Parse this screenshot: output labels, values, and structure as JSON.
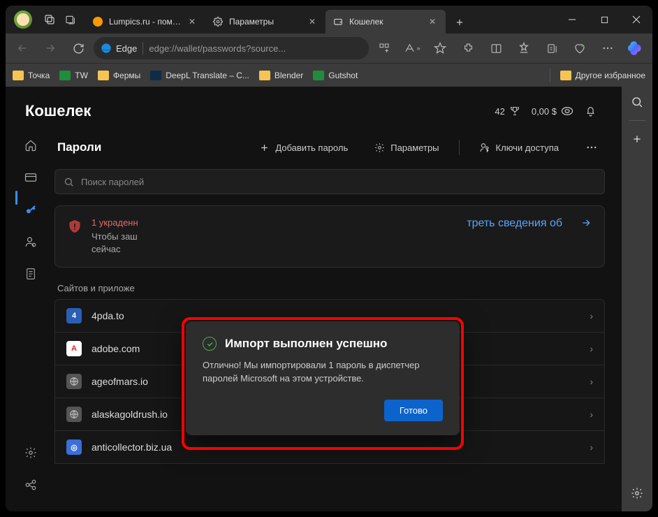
{
  "tabs": [
    {
      "label": "Lumpics.ru - помощь с",
      "favicon_color": "#ff9800"
    },
    {
      "label": "Параметры",
      "favicon": "gear"
    },
    {
      "label": "Кошелек",
      "favicon": "wallet",
      "active": true
    }
  ],
  "addressbar": {
    "browser_label": "Edge",
    "url": "edge://wallet/passwords?source..."
  },
  "bookmarks": [
    {
      "label": "Точка",
      "type": "folder"
    },
    {
      "label": "TW",
      "type": "sheet"
    },
    {
      "label": "Фермы",
      "type": "folder"
    },
    {
      "label": "DeepL Translate – C...",
      "type": "deepl"
    },
    {
      "label": "Blender",
      "type": "folder"
    },
    {
      "label": "Gutshot",
      "type": "sheet"
    }
  ],
  "bookmarks_other": "Другое избранное",
  "wallet": {
    "title": "Кошелек",
    "stats_count": "42",
    "stats_money": "0,00 $",
    "section": "Пароли",
    "add_label": "Добавить пароль",
    "params_label": "Параметры",
    "keys_label": "Ключи доступа",
    "search_placeholder": "Поиск паролей",
    "alert": {
      "title": "1 украденн",
      "body_line1": "Чтобы заш",
      "body_line2": "сейчас",
      "link": "треть сведения об"
    },
    "sites_heading": "Сайтов и приложе",
    "sites": [
      {
        "domain": "4pda.to",
        "icon_bg": "#2b5fb5",
        "icon_txt": "4",
        "icon_fg": "#fff"
      },
      {
        "domain": "adobe.com",
        "icon_bg": "#ffffff",
        "icon_txt": "A",
        "icon_fg": "#e1251b"
      },
      {
        "domain": "ageofmars.io",
        "icon_bg": "#555",
        "icon_txt": "⊕",
        "icon_fg": "#ccc"
      },
      {
        "domain": "alaskagoldrush.io",
        "icon_bg": "#555",
        "icon_txt": "⊕",
        "icon_fg": "#ccc"
      },
      {
        "domain": "anticollector.biz.ua",
        "icon_bg": "#3a6fd8",
        "icon_txt": "◎",
        "icon_fg": "#fff"
      }
    ]
  },
  "modal": {
    "title": "Импорт выполнен успешно",
    "body": "Отлично! Мы импортировали 1 пароль в диспетчер паролей Microsoft на этом устройстве.",
    "done": "Готово"
  }
}
